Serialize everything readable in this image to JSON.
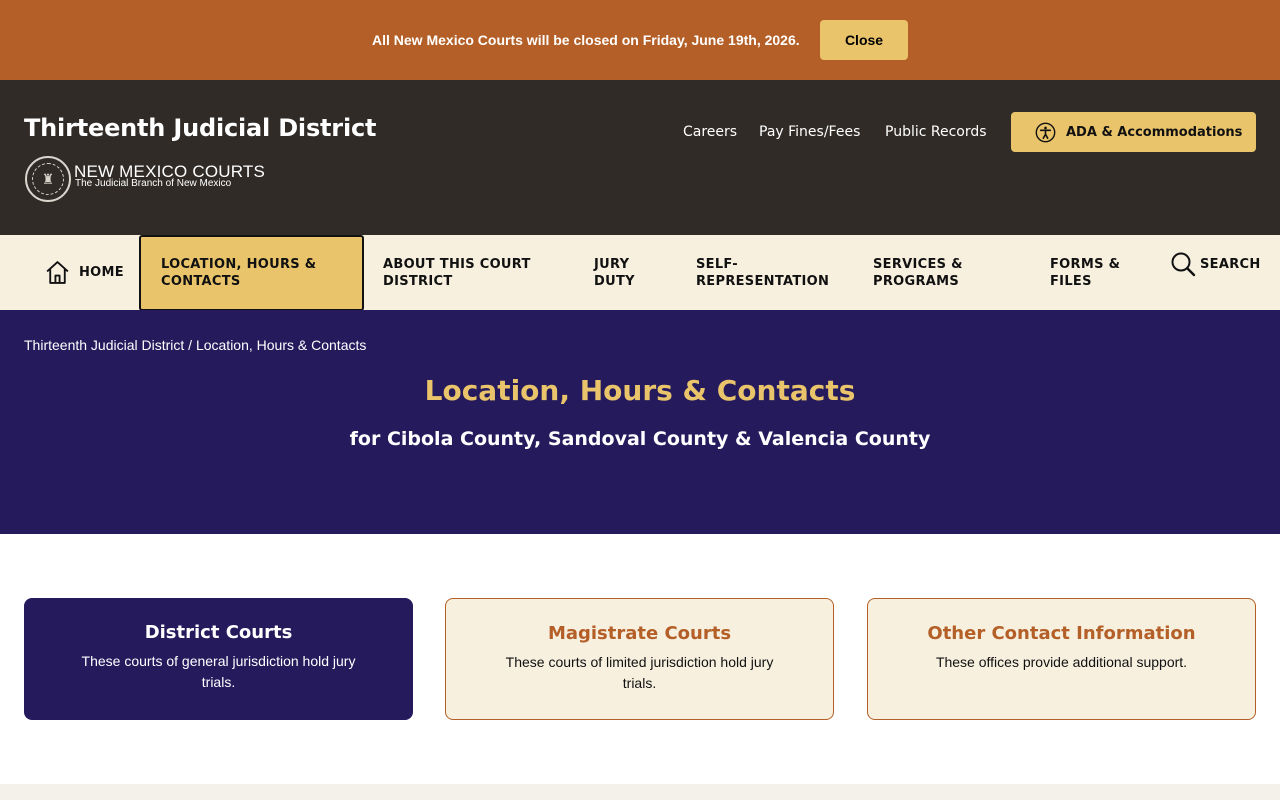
{
  "alert": {
    "message": "All New Mexico Courts will be closed on Friday, June 19th, 2026.",
    "close_label": "Close"
  },
  "header": {
    "title": "Thirteenth Judicial District",
    "brand_name": "NEW MEXICO COURTS",
    "brand_tagline": "The Judicial Branch of New Mexico",
    "utility_links": [
      "Careers",
      "Pay Fines/Fees",
      "Public Records"
    ],
    "ada_label": "ADA & Accommodations"
  },
  "nav": {
    "home": "HOME",
    "location": "LOCATION, HOURS & CONTACTS",
    "about": "ABOUT THIS COURT DISTRICT",
    "jury": "JURY DUTY",
    "self_rep": "SELF-REPRESENTATION",
    "services": "SERVICES & PROGRAMS",
    "forms": "FORMS & FILES",
    "search": "SEARCH"
  },
  "hero": {
    "breadcrumb": "Thirteenth Judicial District / Location, Hours & Contacts",
    "title": "Location, Hours & Contacts",
    "subtitle": "for Cibola County, Sandoval County & Valencia County"
  },
  "cards": [
    {
      "title": "District Courts",
      "description": "These courts of general jurisdiction hold jury trials."
    },
    {
      "title": "Magistrate Courts",
      "description": "These courts of limited jurisdiction hold jury trials."
    },
    {
      "title": "Other Contact Information",
      "description": "These offices provide additional support."
    }
  ],
  "colors": {
    "alert_bg": "#b45f27",
    "header_bg": "#302b27",
    "accent_gold": "#e9c46a",
    "nav_bg": "#f7f0df",
    "hero_bg": "#241a5c"
  }
}
